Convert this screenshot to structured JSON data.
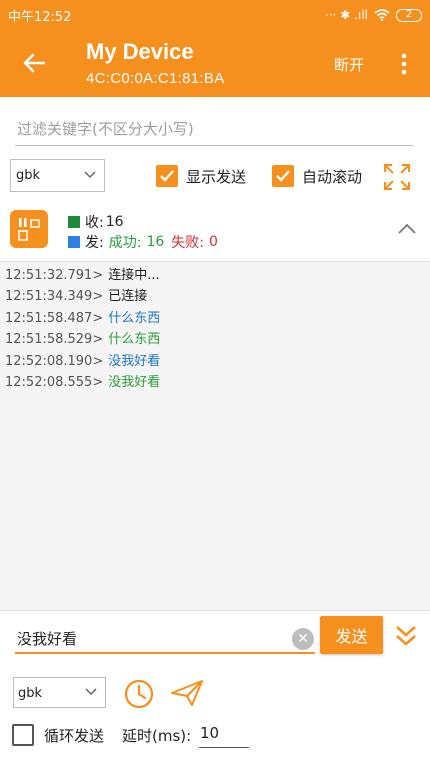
{
  "status_bar": {
    "time": "中午12:52",
    "indicators": "··· ✱ .ıll",
    "battery": "2"
  },
  "app_bar": {
    "title": "My Device",
    "subtitle": "4C:C0:0A:C1:81:BA",
    "disconnect_label": "断开"
  },
  "filter": {
    "placeholder": "过滤关键字(不区分大小写)"
  },
  "options": {
    "encoding": "gbk",
    "show_sent_label": "显示发送",
    "show_sent_checked": true,
    "auto_scroll_label": "自动滚动",
    "auto_scroll_checked": true
  },
  "stats": {
    "received_label": "收:",
    "received_count": "16",
    "sent_label": "发:",
    "success_label": "成功:",
    "success_count": "16",
    "fail_label": "失败:",
    "fail_count": "0",
    "received_color": "#1e8a3a",
    "sent_color": "#2f7fe0"
  },
  "log": [
    {
      "time": "12:51:32.791>",
      "msg": "连接中...",
      "kind": "sys"
    },
    {
      "time": "12:51:34.349>",
      "msg": "已连接",
      "kind": "sys"
    },
    {
      "time": "12:51:58.487>",
      "msg": "什么东西",
      "kind": "sent"
    },
    {
      "time": "12:51:58.529>",
      "msg": "什么东西",
      "kind": "recv"
    },
    {
      "time": "12:52:08.190>",
      "msg": "没我好看",
      "kind": "sent"
    },
    {
      "time": "12:52:08.555>",
      "msg": "没我好看",
      "kind": "recv"
    }
  ],
  "send": {
    "input_value": "没我好看",
    "send_label": "发送",
    "encoding": "gbk",
    "loop_label": "循环发送",
    "loop_checked": false,
    "delay_label": "延时(ms):",
    "delay_value": "10"
  },
  "colors": {
    "accent": "#f5901e",
    "sent_text": "#1e74c8",
    "recv_text": "#2a9d3a",
    "fail_text": "#d32f2f"
  }
}
